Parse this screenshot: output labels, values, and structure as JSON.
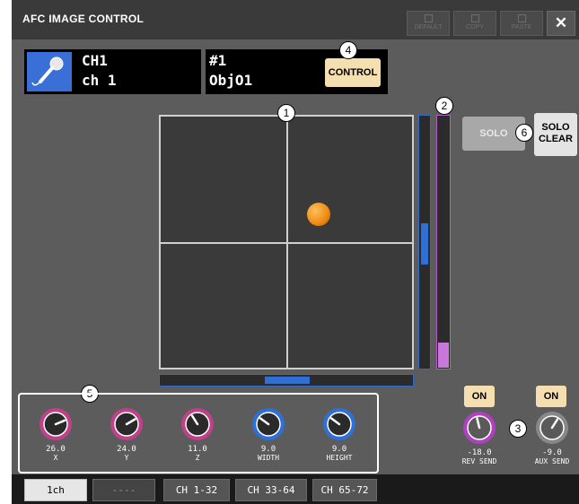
{
  "window": {
    "title": "AFC IMAGE CONTROL"
  },
  "toolbar": {
    "default_label": "DEFAULT",
    "copy_label": "COPY",
    "paste_label": "PASTE",
    "close_label": "✕"
  },
  "channel": {
    "number": "CH1",
    "name": "ch 1",
    "icon": "microphone-icon",
    "icon_color": "#3a6fd8"
  },
  "object": {
    "number": "#1",
    "name": "ObjO1",
    "control_label": "CONTROL"
  },
  "pad": {
    "x_position": 0.63,
    "y_position": 0.39,
    "puck_color": "#ef8a10"
  },
  "sliders": {
    "y_thumb": 0.5,
    "z_fill": 0.1,
    "x_thumb": 0.5
  },
  "solo": {
    "solo_label": "SOLO",
    "solo_clear_line1": "SOLO",
    "solo_clear_line2": "CLEAR"
  },
  "callouts": [
    "1",
    "2",
    "3",
    "4",
    "5",
    "6"
  ],
  "knobs": [
    {
      "value": "26.0",
      "label": "X",
      "color": "#c0408a",
      "level": 0.75
    },
    {
      "value": "24.0",
      "label": "Y",
      "color": "#c0408a",
      "level": 0.72
    },
    {
      "value": "11.0",
      "label": "Z",
      "color": "#c0408a",
      "level": 0.38
    },
    {
      "value": "9.0",
      "label": "WIDTH",
      "color": "#2f6fd8",
      "level": 0.3
    },
    {
      "value": "9.0",
      "label": "HEIGHT",
      "color": "#2f6fd8",
      "level": 0.3
    }
  ],
  "sends": [
    {
      "on_label": "ON",
      "value": "-18.0",
      "label": "REV SEND",
      "ring_color": "#b040c0",
      "level": 0.45
    },
    {
      "on_label": "ON",
      "value": "-9.0",
      "label": "AUX SEND",
      "ring_color": "#888888",
      "level": 0.62
    }
  ],
  "tabs": [
    {
      "label": "1ch",
      "active": true
    },
    {
      "label": "----",
      "active": false
    },
    {
      "label": "CH 1-32",
      "active": false
    },
    {
      "label": "CH 33-64",
      "active": false
    },
    {
      "label": "CH 65-72",
      "active": false
    }
  ]
}
